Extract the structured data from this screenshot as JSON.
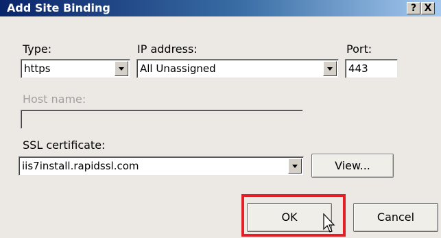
{
  "window": {
    "title": "Add Site Binding",
    "help_label": "?",
    "close_label": "X"
  },
  "type": {
    "label": "Type:",
    "value": "https"
  },
  "ip": {
    "label": "IP address:",
    "value": "All Unassigned"
  },
  "port": {
    "label": "Port:",
    "value": "443"
  },
  "host": {
    "label": "Host name:",
    "value": ""
  },
  "ssl": {
    "label": "SSL certificate:",
    "value": "iis7install.rapidssl.com",
    "view_label": "View..."
  },
  "buttons": {
    "ok_label": "OK",
    "cancel_label": "Cancel"
  },
  "colors": {
    "highlight": "#e41e26",
    "titlebar": "#0a246a"
  }
}
